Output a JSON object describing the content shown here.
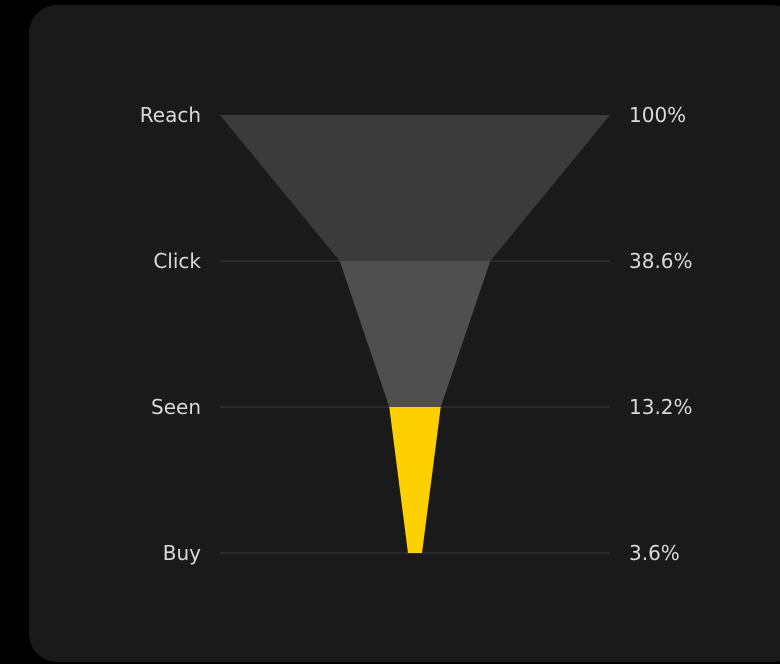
{
  "chart_data": {
    "type": "funnel",
    "title": "",
    "stages": [
      {
        "label": "Reach",
        "value": 100,
        "value_label": "100%"
      },
      {
        "label": "Click",
        "value": 38.6,
        "value_label": "38.6%"
      },
      {
        "label": "Seen",
        "value": 13.2,
        "value_label": "13.2%"
      },
      {
        "label": "Buy",
        "value": 3.6,
        "value_label": "3.6%"
      }
    ],
    "segment_colors": [
      "#3c3b3c",
      "#4f4f4f",
      "#ffd000"
    ],
    "grid": true,
    "legend": "none"
  },
  "colors": {
    "background": "#000000",
    "card": "#1a1a1a",
    "text": "#d9d9d9",
    "grid": "#3a3a3a"
  }
}
